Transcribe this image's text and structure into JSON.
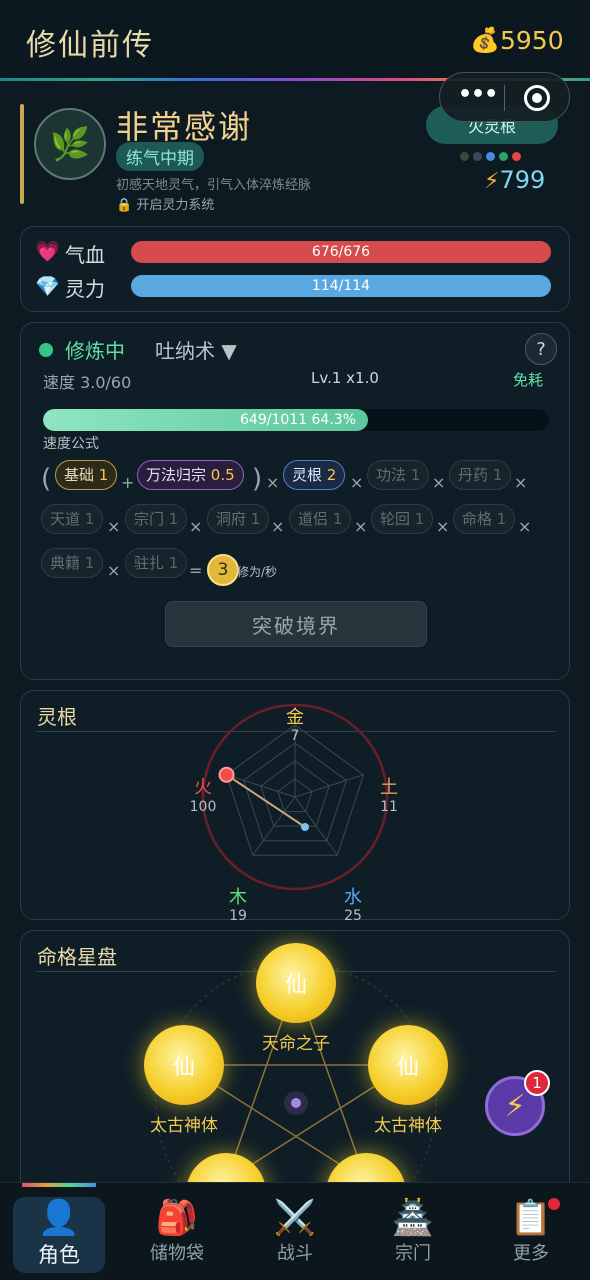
{
  "header": {
    "title": "修仙前传",
    "coin_icon": "💰",
    "coins": "5950"
  },
  "capsule": {
    "more_icon": "•••"
  },
  "profile": {
    "avatar_icon": "🌿",
    "name": "非常感谢",
    "realm": "练气中期",
    "description": "初感天地灵气，引气入体淬炼经脉",
    "lock_text": "开启灵力系统",
    "root_button": "火灵根",
    "energy_icon": "⚡",
    "energy": "799",
    "root_dot_colors": [
      "#2e4d3a",
      "#3b4a52",
      "#4a8ae0",
      "#2aa36a",
      "#e04848"
    ]
  },
  "stats": {
    "hp": {
      "label": "气血",
      "icon": "💗",
      "text": "676/676",
      "fill": 1.0,
      "color": "#d64b4b"
    },
    "mp": {
      "label": "灵力",
      "icon": "💎",
      "text": "114/114",
      "fill": 1.0,
      "color": "#5aa8e0"
    }
  },
  "cultivation": {
    "status": "修炼中",
    "technique": "吐纳术 ▼",
    "help": "?",
    "free": "免耗",
    "speed": "速度 3.0/60",
    "level": "Lv.1 x1.0",
    "progress_text": "649/1011  64.3%",
    "progress_fraction": 0.643,
    "formula_label": "速度公式",
    "chips": [
      {
        "name": "基础",
        "value": "1",
        "style": "gold"
      },
      {
        "name": "万法归宗",
        "value": "0.5",
        "style": "purple"
      },
      {
        "name": "灵根",
        "value": "2",
        "style": "blue"
      },
      {
        "name": "功法",
        "value": "1",
        "style": "dim"
      },
      {
        "name": "丹药",
        "value": "1",
        "style": "dim"
      },
      {
        "name": "天道",
        "value": "1",
        "style": "dim"
      },
      {
        "name": "宗门",
        "value": "1",
        "style": "dim"
      },
      {
        "name": "洞府",
        "value": "1",
        "style": "dim"
      },
      {
        "name": "道侣",
        "value": "1",
        "style": "dim"
      },
      {
        "name": "轮回",
        "value": "1",
        "style": "dim"
      },
      {
        "name": "命格",
        "value": "1",
        "style": "dim"
      },
      {
        "name": "典籍",
        "value": "1",
        "style": "dim"
      },
      {
        "name": "驻扎",
        "value": "1",
        "style": "dim"
      }
    ],
    "ops": {
      "plus": "+",
      "times": "×",
      "equals": "=",
      "lparen": "(",
      "rparen": ")"
    },
    "result": "3",
    "result_unit": "修为/秒",
    "breakthrough": "突破境界"
  },
  "spirit_root": {
    "title": "灵根",
    "elements": [
      {
        "name": "金",
        "value": "7",
        "color": "#f2c94c"
      },
      {
        "name": "土",
        "value": "11",
        "color": "#e0a05a"
      },
      {
        "name": "水",
        "value": "25",
        "color": "#5aa8f2"
      },
      {
        "name": "木",
        "value": "19",
        "color": "#5fe07a"
      },
      {
        "name": "火",
        "value": "100",
        "color": "#f24b4b"
      }
    ]
  },
  "star_chart": {
    "title": "命格星盘",
    "orb_char": "仙",
    "orbs": [
      {
        "label": "天命之子"
      },
      {
        "label": "太古神体"
      },
      {
        "label": "太古神体"
      }
    ]
  },
  "fab": {
    "icon": "⚡",
    "badge": "1"
  },
  "nav": [
    {
      "icon": "👤",
      "label": "角色"
    },
    {
      "icon": "🎒",
      "label": "储物袋"
    },
    {
      "icon": "⚔️",
      "label": "战斗"
    },
    {
      "icon": "🏯",
      "label": "宗门"
    },
    {
      "icon": "📋",
      "label": "更多"
    }
  ]
}
